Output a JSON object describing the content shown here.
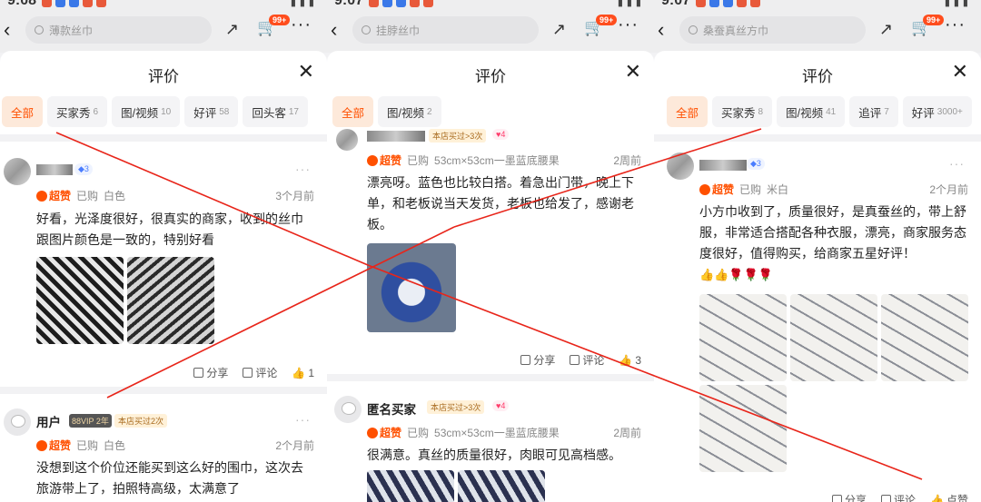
{
  "status": {
    "time_left": "9:08",
    "time_mid": "9:07",
    "time_right": "9:07"
  },
  "common": {
    "sheet_title": "评价",
    "close_glyph": "✕",
    "cart_badge": "99+",
    "share_label": "分享",
    "comment_label": "评论",
    "zan_label": "超赞",
    "bought_prefix": "已购",
    "more_glyph": "···"
  },
  "panels": [
    {
      "search_placeholder": "薄款丝巾",
      "tabs": [
        {
          "label": "全部",
          "count": ""
        },
        {
          "label": "买家秀",
          "count": "6"
        },
        {
          "label": "图/视频",
          "count": "10"
        },
        {
          "label": "好评",
          "count": "58"
        },
        {
          "label": "回头客",
          "count": "17"
        }
      ],
      "reviews": [
        {
          "name": "",
          "level": "3",
          "variant": "白色",
          "date": "3个月前",
          "text": "好看，光泽度很好，很真实的商家，收到的丝巾跟图片颜色是一致的，特别好看",
          "like_count": "1"
        },
        {
          "name": "用户",
          "vip": "88VIP",
          "vip_year": "2年",
          "store": "本店买过2次",
          "variant": "白色",
          "date": "2个月前",
          "text": "没想到这个价位还能买到这么好的围巾，这次去旅游带上了，拍照特高级，太满意了"
        }
      ]
    },
    {
      "search_placeholder": "挂脖丝巾",
      "tabs": [
        {
          "label": "全部",
          "count": ""
        },
        {
          "label": "图/视频",
          "count": "2"
        }
      ],
      "reviews": [
        {
          "name": "",
          "store": "本店买过>3次",
          "level": "4",
          "variant": "53cm×53cm一墨蓝底腰果",
          "date": "2周前",
          "text": "漂亮呀。蓝色也比较白搭。着急出门带，晚上下单，和老板说当天发货，老板也给发了，感谢老板。",
          "like_count": "3"
        },
        {
          "name": "匿名买家",
          "store": "本店买过>3次",
          "level": "4",
          "variant": "53cm×53cm一墨蓝底腰果",
          "date": "2周前",
          "text": "很满意。真丝的质量很好，肉眼可见高档感。"
        }
      ]
    },
    {
      "search_placeholder": "桑蚕真丝方巾",
      "tabs": [
        {
          "label": "全部",
          "count": ""
        },
        {
          "label": "买家秀",
          "count": "8"
        },
        {
          "label": "图/视频",
          "count": "41"
        },
        {
          "label": "追评",
          "count": "7"
        },
        {
          "label": "好评",
          "count": "3000+"
        }
      ],
      "reviews": [
        {
          "name": "",
          "level": "3",
          "variant": "米白",
          "date": "2个月前",
          "text": "小方巾收到了，质量很好，是真蚕丝的，带上舒服，非常适合搭配各种衣服，漂亮，商家服务态度很好，值得购买，给商家五星好评！",
          "emoji": "👍👍🌹🌹🌹",
          "like_label": "点赞"
        }
      ]
    }
  ]
}
